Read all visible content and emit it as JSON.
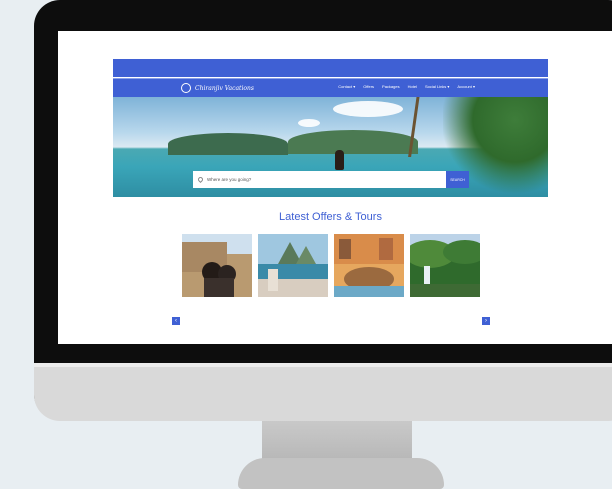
{
  "site": {
    "brand": "Chiranjiv Vacations",
    "nav": [
      "Contact ▾",
      "Offers",
      "Packages",
      "Hotel",
      "Social Links ▾",
      "Account ▾"
    ],
    "search": {
      "placeholder": "Where are you going?",
      "button": "SEARCH"
    },
    "section_title": "Latest Offers & Tours",
    "cards": [
      {
        "name": "rome-colosseum-couple"
      },
      {
        "name": "mountain-view-terrace"
      },
      {
        "name": "fountain-square"
      },
      {
        "name": "waterfall-jungle"
      }
    ],
    "arrows": {
      "prev": "‹",
      "next": "›"
    },
    "colors": {
      "brand": "#3f60d4"
    }
  }
}
